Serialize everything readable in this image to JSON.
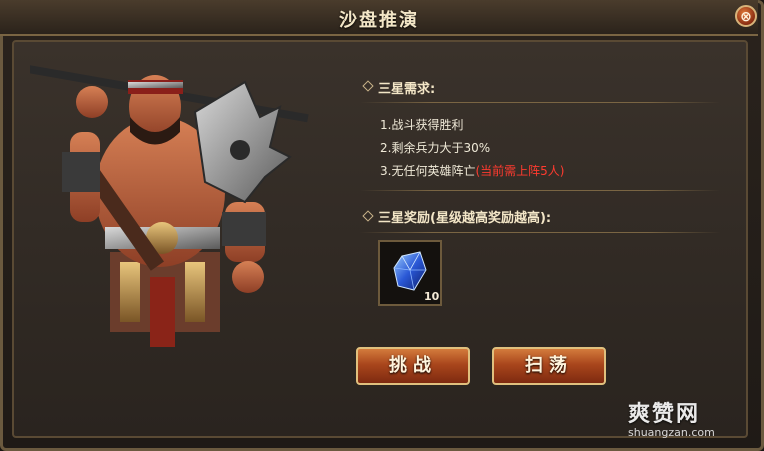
{
  "window": {
    "title": "沙盘推演",
    "close_label": "⊗"
  },
  "requirements": {
    "title": "三星需求:",
    "items": [
      {
        "text": "1.战斗获得胜利",
        "note": ""
      },
      {
        "text": "2.剩余兵力大于30%",
        "note": ""
      },
      {
        "text": "3.无任何英雄阵亡",
        "note": "(当前需上阵5人)"
      }
    ]
  },
  "rewards": {
    "title": "三星奖励(星级越高奖励越高):",
    "items": [
      {
        "icon": "blue-crystal-icon",
        "count": "10"
      }
    ]
  },
  "buttons": {
    "challenge": "挑战",
    "sweep": "扫荡"
  },
  "watermark": {
    "text": "爽赞网",
    "url": "shuangzan.com"
  },
  "colors": {
    "accent": "#d37b3c",
    "note_red": "#ff3b2f",
    "frame_gold": "#7a6543"
  }
}
